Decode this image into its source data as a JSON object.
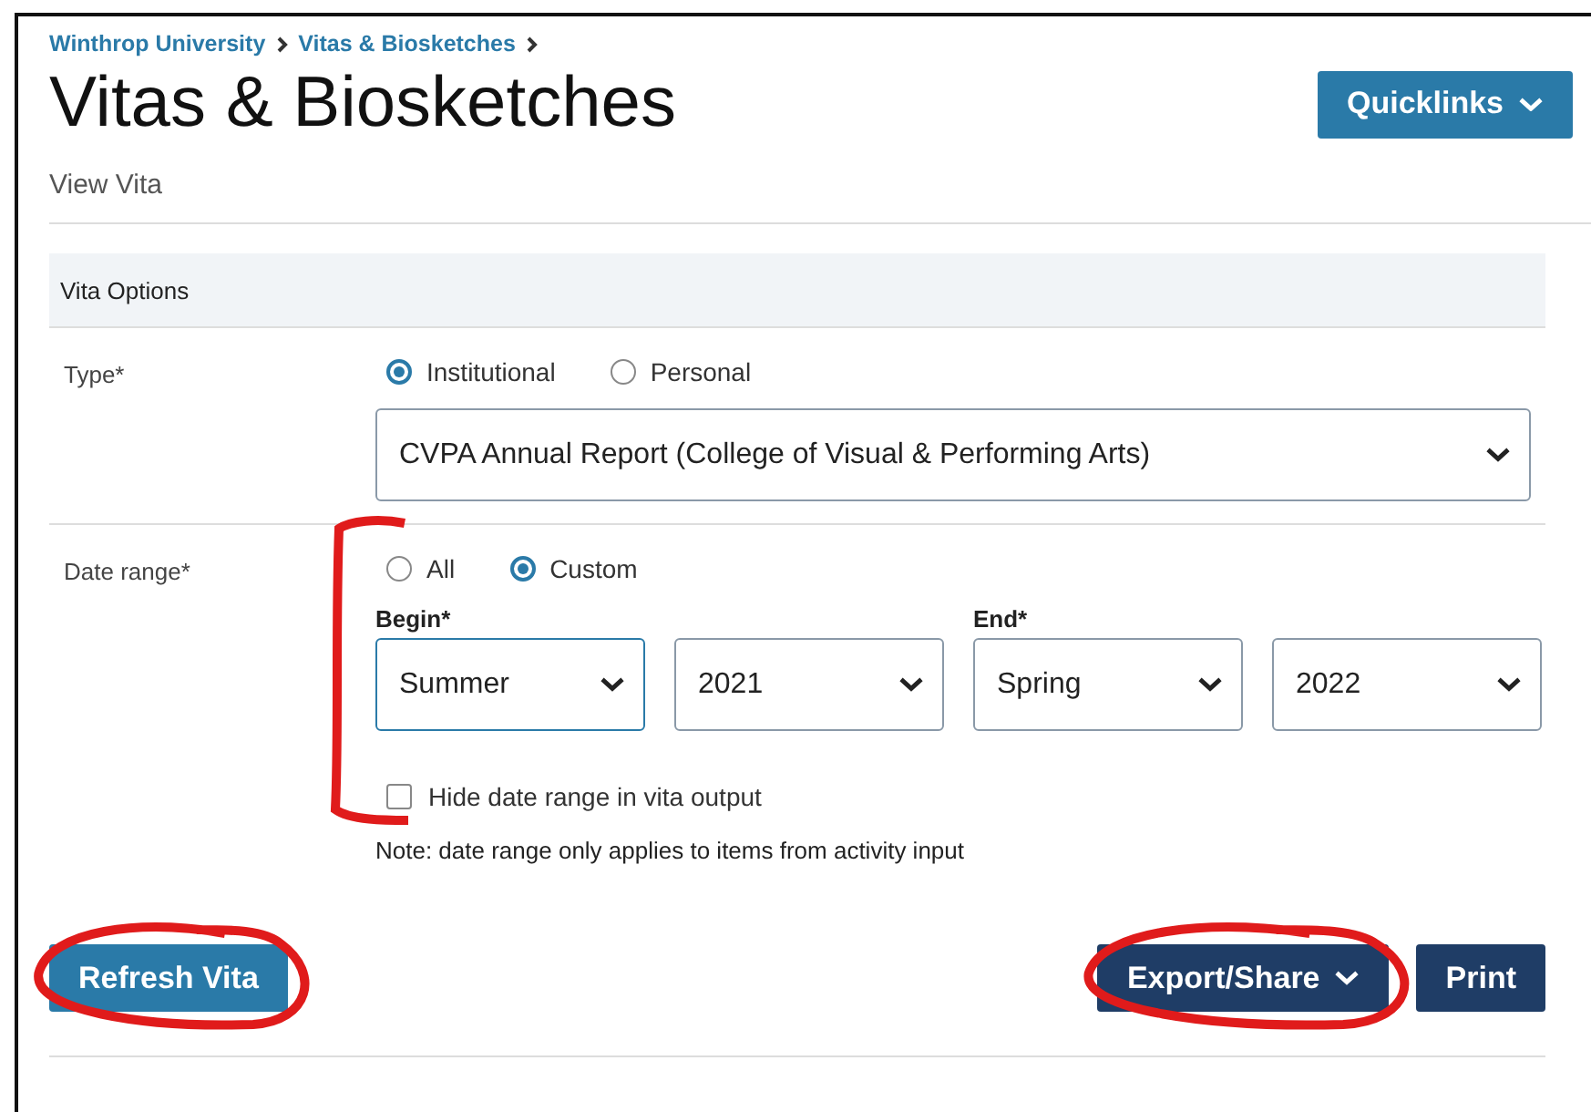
{
  "breadcrumb": [
    "Winthrop University",
    "Vitas & Biosketches"
  ],
  "title": "Vitas & Biosketches",
  "quicklinks": {
    "label": "Quicklinks"
  },
  "subtitle": "View Vita",
  "panel": {
    "title": "Vita Options",
    "type": {
      "label": "Type*",
      "options": [
        {
          "label": "Institutional",
          "selected": true
        },
        {
          "label": "Personal",
          "selected": false
        }
      ],
      "template": "CVPA Annual Report (College of Visual & Performing Arts)"
    },
    "date_range": {
      "label": "Date range*",
      "marked": true,
      "options": [
        {
          "label": "All",
          "selected": false
        },
        {
          "label": "Custom",
          "selected": true
        }
      ],
      "groups": [
        {
          "label": "Begin*",
          "selects": [
            {
              "value": "Summer",
              "focused": true
            },
            {
              "value": "2021",
              "focused": false
            }
          ]
        },
        {
          "label": "End*",
          "selects": [
            {
              "value": "Spring",
              "focused": false
            },
            {
              "value": "2022",
              "focused": false
            }
          ]
        }
      ],
      "hide_checkbox": {
        "label": "Hide date range in vita output",
        "checked": false
      },
      "note": "Note: date range only applies to items from activity input"
    }
  },
  "buttons": [
    {
      "label": "Refresh Vita",
      "kind": "primary",
      "marked": true,
      "caret": false
    },
    {
      "label": "Export/Share",
      "kind": "dark",
      "marked": true,
      "caret": true
    },
    {
      "label": "Print",
      "kind": "dark",
      "marked": false,
      "caret": false
    }
  ]
}
